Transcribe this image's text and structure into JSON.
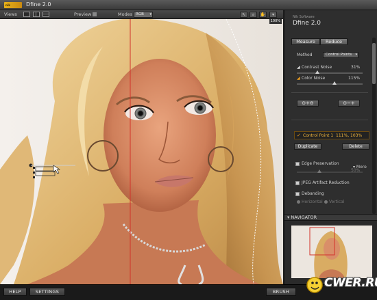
{
  "app": {
    "title": "Dfine 2.0",
    "logo_text": "nik"
  },
  "toolbar": {
    "views_label": "Views",
    "preview_label": "Preview",
    "modes_label": "Modes",
    "modes_value": "RGB",
    "tools": [
      "zoom-in-icon",
      "zoom-out-icon",
      "hand-icon",
      "pin-icon"
    ]
  },
  "canvas": {
    "zoom": "100%"
  },
  "panel": {
    "brand_small": "Nik Software",
    "brand_title": "Dfine 2.0",
    "tabs": {
      "measure": "Measure",
      "reduce": "Reduce",
      "active": "reduce"
    },
    "method_label": "Method",
    "method_value": "Control Points",
    "contrast_noise": {
      "label": "Contrast Noise",
      "value": "31%",
      "level": 0.31
    },
    "color_noise": {
      "label": "Color Noise",
      "value": "115%",
      "level": 0.575
    },
    "control_point_row": "Control Point 1",
    "control_point_values": "111%, 103%",
    "duplicate": "Duplicate",
    "delete": "Delete",
    "more": "More",
    "edge_preservation": {
      "label": "Edge Preservation",
      "value": "50%"
    },
    "jpeg": "JPEG Artifact Reduction",
    "debanding": "Debanding",
    "horizontal": "Horizontal",
    "vertical": "Vertical"
  },
  "navigator": {
    "title": "NAVIGATOR"
  },
  "bottom": {
    "help": "HELP",
    "settings": "SETTINGS",
    "brush": "BRUSH"
  },
  "watermark": "CWER.RU"
}
